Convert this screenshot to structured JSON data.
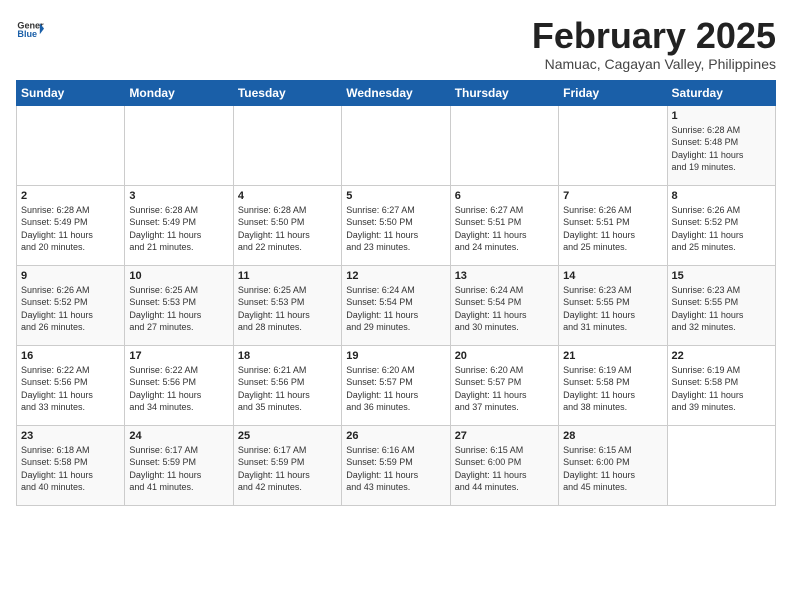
{
  "header": {
    "logo_general": "General",
    "logo_blue": "Blue",
    "title": "February 2025",
    "subtitle": "Namuac, Cagayan Valley, Philippines"
  },
  "days_of_week": [
    "Sunday",
    "Monday",
    "Tuesday",
    "Wednesday",
    "Thursday",
    "Friday",
    "Saturday"
  ],
  "weeks": [
    [
      {
        "day": "",
        "info": ""
      },
      {
        "day": "",
        "info": ""
      },
      {
        "day": "",
        "info": ""
      },
      {
        "day": "",
        "info": ""
      },
      {
        "day": "",
        "info": ""
      },
      {
        "day": "",
        "info": ""
      },
      {
        "day": "1",
        "info": "Sunrise: 6:28 AM\nSunset: 5:48 PM\nDaylight: 11 hours\nand 19 minutes."
      }
    ],
    [
      {
        "day": "2",
        "info": "Sunrise: 6:28 AM\nSunset: 5:49 PM\nDaylight: 11 hours\nand 20 minutes."
      },
      {
        "day": "3",
        "info": "Sunrise: 6:28 AM\nSunset: 5:49 PM\nDaylight: 11 hours\nand 21 minutes."
      },
      {
        "day": "4",
        "info": "Sunrise: 6:28 AM\nSunset: 5:50 PM\nDaylight: 11 hours\nand 22 minutes."
      },
      {
        "day": "5",
        "info": "Sunrise: 6:27 AM\nSunset: 5:50 PM\nDaylight: 11 hours\nand 23 minutes."
      },
      {
        "day": "6",
        "info": "Sunrise: 6:27 AM\nSunset: 5:51 PM\nDaylight: 11 hours\nand 24 minutes."
      },
      {
        "day": "7",
        "info": "Sunrise: 6:26 AM\nSunset: 5:51 PM\nDaylight: 11 hours\nand 25 minutes."
      },
      {
        "day": "8",
        "info": "Sunrise: 6:26 AM\nSunset: 5:52 PM\nDaylight: 11 hours\nand 25 minutes."
      }
    ],
    [
      {
        "day": "9",
        "info": "Sunrise: 6:26 AM\nSunset: 5:52 PM\nDaylight: 11 hours\nand 26 minutes."
      },
      {
        "day": "10",
        "info": "Sunrise: 6:25 AM\nSunset: 5:53 PM\nDaylight: 11 hours\nand 27 minutes."
      },
      {
        "day": "11",
        "info": "Sunrise: 6:25 AM\nSunset: 5:53 PM\nDaylight: 11 hours\nand 28 minutes."
      },
      {
        "day": "12",
        "info": "Sunrise: 6:24 AM\nSunset: 5:54 PM\nDaylight: 11 hours\nand 29 minutes."
      },
      {
        "day": "13",
        "info": "Sunrise: 6:24 AM\nSunset: 5:54 PM\nDaylight: 11 hours\nand 30 minutes."
      },
      {
        "day": "14",
        "info": "Sunrise: 6:23 AM\nSunset: 5:55 PM\nDaylight: 11 hours\nand 31 minutes."
      },
      {
        "day": "15",
        "info": "Sunrise: 6:23 AM\nSunset: 5:55 PM\nDaylight: 11 hours\nand 32 minutes."
      }
    ],
    [
      {
        "day": "16",
        "info": "Sunrise: 6:22 AM\nSunset: 5:56 PM\nDaylight: 11 hours\nand 33 minutes."
      },
      {
        "day": "17",
        "info": "Sunrise: 6:22 AM\nSunset: 5:56 PM\nDaylight: 11 hours\nand 34 minutes."
      },
      {
        "day": "18",
        "info": "Sunrise: 6:21 AM\nSunset: 5:56 PM\nDaylight: 11 hours\nand 35 minutes."
      },
      {
        "day": "19",
        "info": "Sunrise: 6:20 AM\nSunset: 5:57 PM\nDaylight: 11 hours\nand 36 minutes."
      },
      {
        "day": "20",
        "info": "Sunrise: 6:20 AM\nSunset: 5:57 PM\nDaylight: 11 hours\nand 37 minutes."
      },
      {
        "day": "21",
        "info": "Sunrise: 6:19 AM\nSunset: 5:58 PM\nDaylight: 11 hours\nand 38 minutes."
      },
      {
        "day": "22",
        "info": "Sunrise: 6:19 AM\nSunset: 5:58 PM\nDaylight: 11 hours\nand 39 minutes."
      }
    ],
    [
      {
        "day": "23",
        "info": "Sunrise: 6:18 AM\nSunset: 5:58 PM\nDaylight: 11 hours\nand 40 minutes."
      },
      {
        "day": "24",
        "info": "Sunrise: 6:17 AM\nSunset: 5:59 PM\nDaylight: 11 hours\nand 41 minutes."
      },
      {
        "day": "25",
        "info": "Sunrise: 6:17 AM\nSunset: 5:59 PM\nDaylight: 11 hours\nand 42 minutes."
      },
      {
        "day": "26",
        "info": "Sunrise: 6:16 AM\nSunset: 5:59 PM\nDaylight: 11 hours\nand 43 minutes."
      },
      {
        "day": "27",
        "info": "Sunrise: 6:15 AM\nSunset: 6:00 PM\nDaylight: 11 hours\nand 44 minutes."
      },
      {
        "day": "28",
        "info": "Sunrise: 6:15 AM\nSunset: 6:00 PM\nDaylight: 11 hours\nand 45 minutes."
      },
      {
        "day": "",
        "info": ""
      }
    ]
  ]
}
